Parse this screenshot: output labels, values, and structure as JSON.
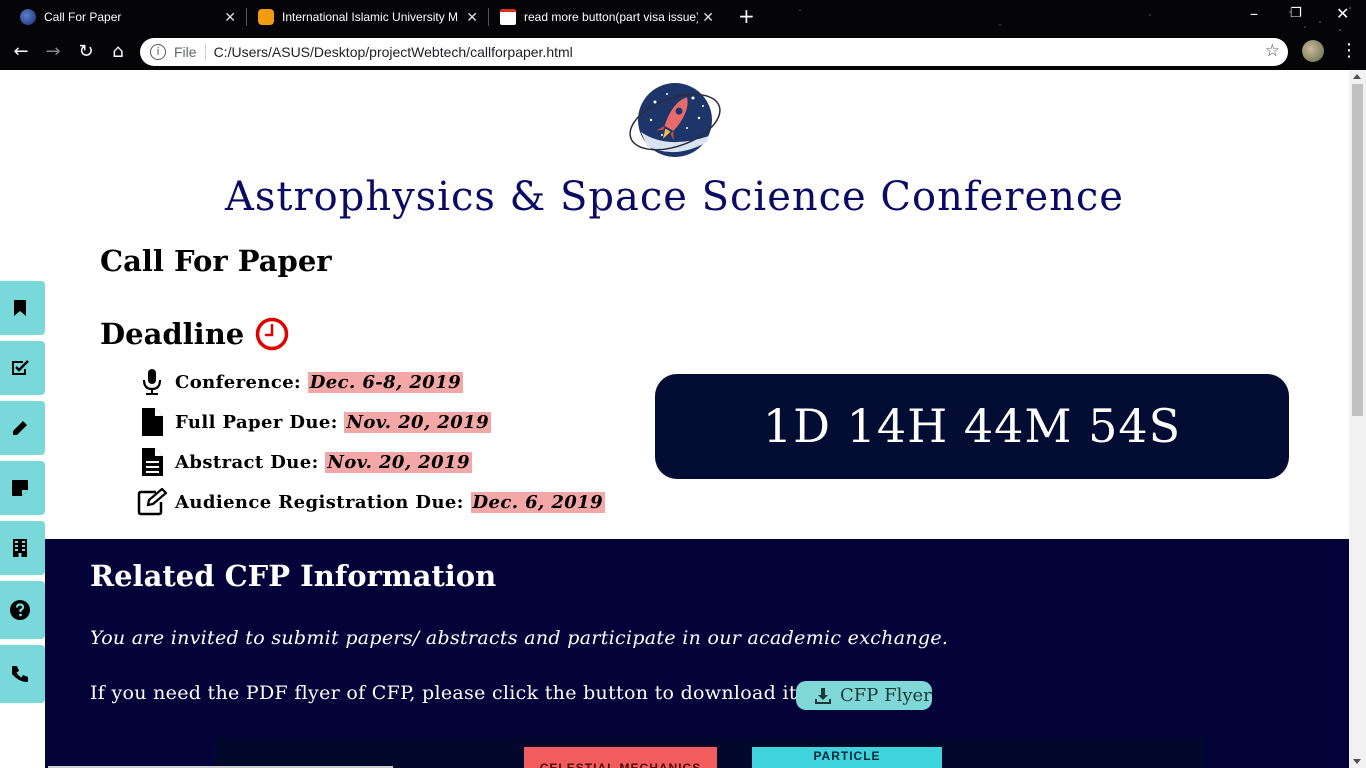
{
  "browser": {
    "tabs": [
      {
        "title": "Call For Paper",
        "active": true
      },
      {
        "title": "International Islamic University M",
        "active": false
      },
      {
        "title": "read more button(part visa issue)",
        "active": false
      }
    ],
    "address": {
      "scheme": "File",
      "url": "C:/Users/ASUS/Desktop/projectWebtech/callforpaper.html"
    }
  },
  "page": {
    "site_title": "Astrophysics & Space Science Conference",
    "cfp_heading": "Call For Paper",
    "deadline_heading": "Deadline",
    "deadlines": [
      {
        "label": "Conference:",
        "date": "Dec. 6-8, 2019",
        "icon": "microphone-icon"
      },
      {
        "label": "Full Paper Due:",
        "date": "Nov. 20, 2019",
        "icon": "file-icon"
      },
      {
        "label": "Abstract Due:",
        "date": "Nov. 20, 2019",
        "icon": "file-text-icon"
      },
      {
        "label": "Audience Registration Due:",
        "date": "Dec. 6, 2019",
        "icon": "edit-icon"
      }
    ],
    "countdown": "1D 14H 44M 54S",
    "related": {
      "heading": "Related CFP Information",
      "invite": "You are invited to submit papers/ abstracts and participate in our academic exchange.",
      "pdf_text": "If you need the PDF flyer of CFP, please click the button to download it.",
      "flyer_button": "CFP Flyer"
    },
    "poster": {
      "chip1": "CELESTIAL MECHANICS",
      "chip2": "PARTICLE"
    },
    "side_menu": [
      "bookmark-icon",
      "check-square-icon",
      "pencil-icon",
      "sticky-note-icon",
      "building-icon",
      "question-circle-icon",
      "phone-icon"
    ]
  },
  "colors": {
    "title": "#0b0b66",
    "countdown_bg": "#030d33",
    "related_bg": "#03033a",
    "accent": "#79d9da",
    "date_highlight": "#f4a7a7"
  }
}
